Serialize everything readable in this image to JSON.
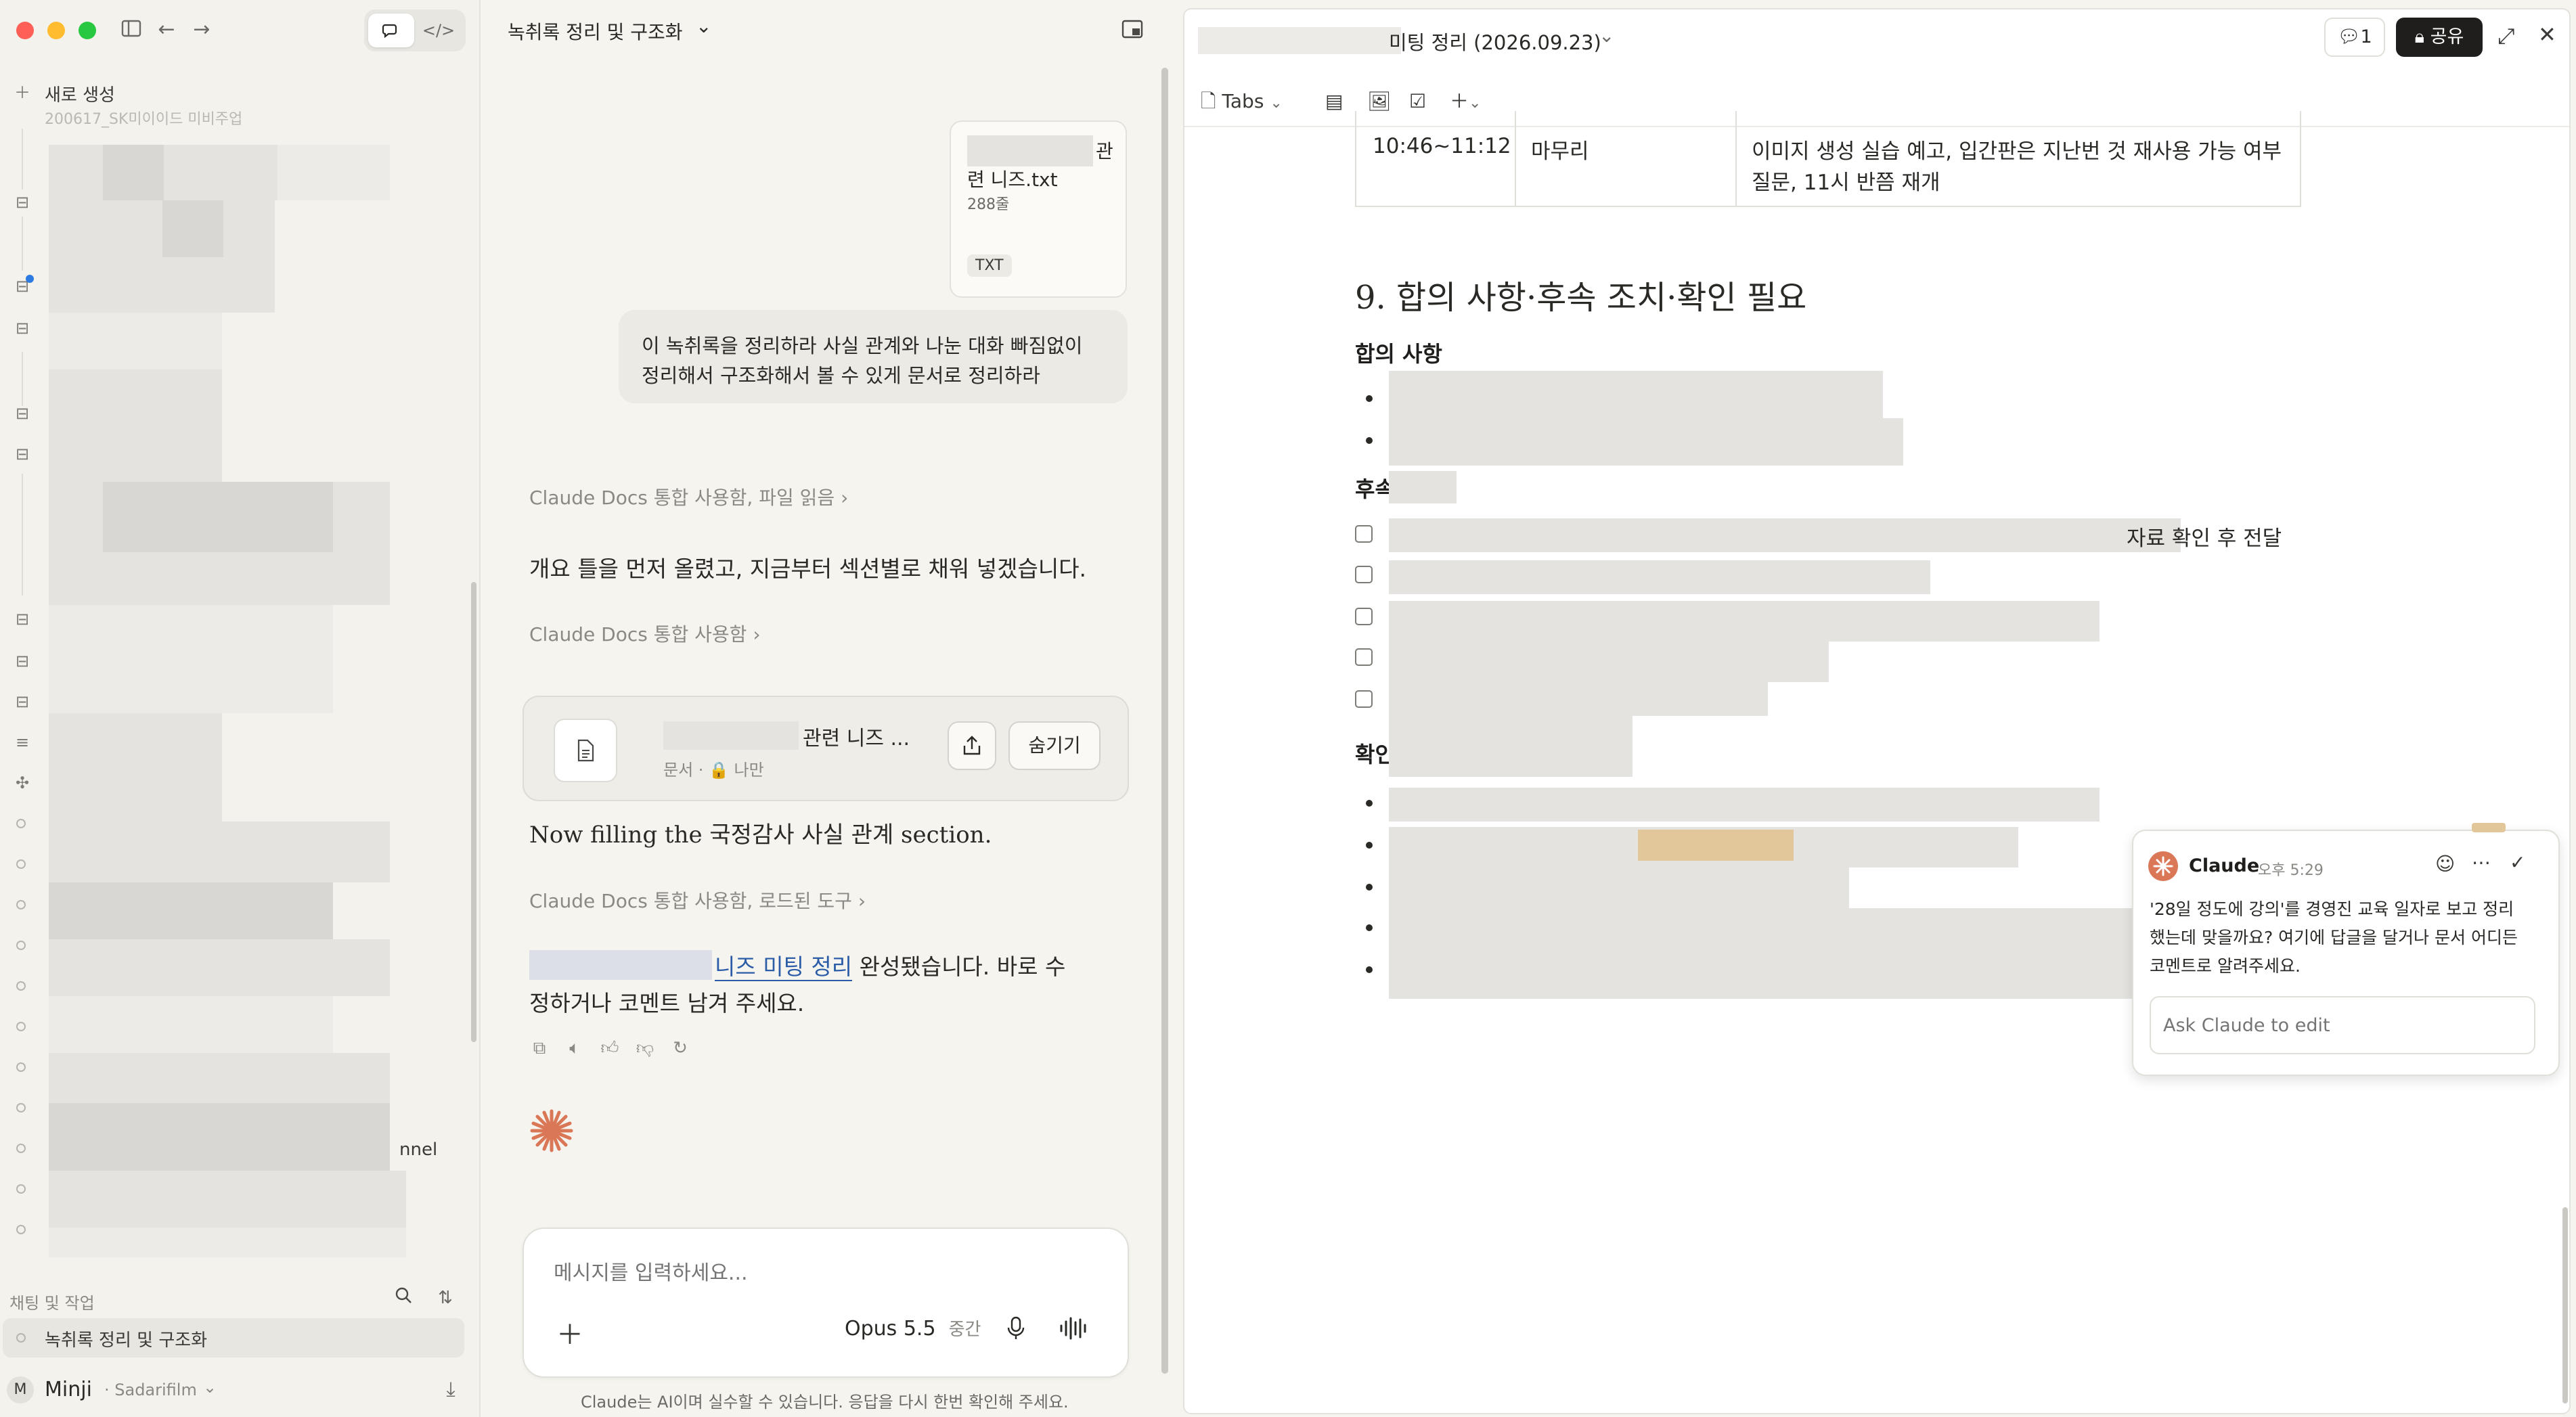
{
  "sidebar": {
    "new_chat_label": "새로 생성",
    "partial_project_label": "200617_SK미이이드 미비주업",
    "partial_channel_text": "nnel",
    "section_label": "채팅 및 작업",
    "active_chat": "녹취록 정리 및 구조화",
    "user": {
      "initial": "M",
      "name": "Minji",
      "org": "· Sadarifilm"
    }
  },
  "chat": {
    "title": "녹취록 정리 및 구조화",
    "attachment": {
      "name_line1": "관",
      "name_line2": "련 니즈.txt",
      "lines": "288줄",
      "type": "TXT"
    },
    "user_message_line1": "이 녹취록을 정리하라 사실 관계와 나눈 대화 빠짐없이",
    "user_message_line2": "정리해서 구조화해서 볼 수 있게 문서로 정리하라",
    "tool_use_1": "Claude Docs 통합 사용함, 파일 읽음",
    "reply_1": "개요 틀을 먼저 올렸고, 지금부터 섹션별로 채워 넣겠습니다.",
    "tool_use_2": "Claude Docs 통합 사용함",
    "artifact": {
      "title_suffix": "관련 니즈 ...",
      "meta": "문서 · 🔒 나만",
      "hide_label": "숨기기"
    },
    "reply_2": "Now filling the 국정감사 사실 관계 section.",
    "tool_use_3": "Claude Docs 통합 사용함, 로드된 도구",
    "reply_3_link": "니즈 미팅 정리",
    "reply_3_rest": " 완성됐습니다. 바로 수",
    "reply_3_line2": "정하거나 코멘트 남겨 주세요.",
    "input_placeholder": "메시지를 입력하세요...",
    "model_name": "Opus 5.5",
    "model_effort": "중간",
    "disclaimer": "Claude는 AI이며 실수할 수 있습니다. 응답을 다시 한번 확인해 주세요."
  },
  "doc": {
    "title_suffix": "미팅 정리 (2026.09.23)",
    "comment_count": "1",
    "share_label": "공유",
    "tabs_label": "Tabs",
    "table_row": {
      "time": "10:46~11:12",
      "phase": "마무리",
      "desc_line1": "이미지 생성 실습 예고, 입간판은 지난번 것 재사용 가능 여부",
      "desc_line2": "질문, 11시 반쯤 재개"
    },
    "section_heading": "9. 합의 사항·후속 조치·확인 필요",
    "sub_agreements": "합의 사항",
    "sub_followup_partial": "후속",
    "sub_confirm_partial": "확인",
    "followup_1_tail": "자료 확인 후 전달"
  },
  "comment": {
    "author": "Claude",
    "time": "오후 5:29",
    "body_line1": "'28일 정도에 강의'를 경영진 교육 일자로 보고 정리",
    "body_line2": "했는데 맞을까요? 여기에 답글을 달거나 문서 어디든",
    "body_line3": "코멘트로 알려주세요.",
    "reply_placeholder": "Ask Claude to edit"
  },
  "colors": {
    "accent": "#d97757",
    "link": "#2b5ca8",
    "share_bg": "#1f1e1c",
    "highlight": "#e2c79a"
  }
}
